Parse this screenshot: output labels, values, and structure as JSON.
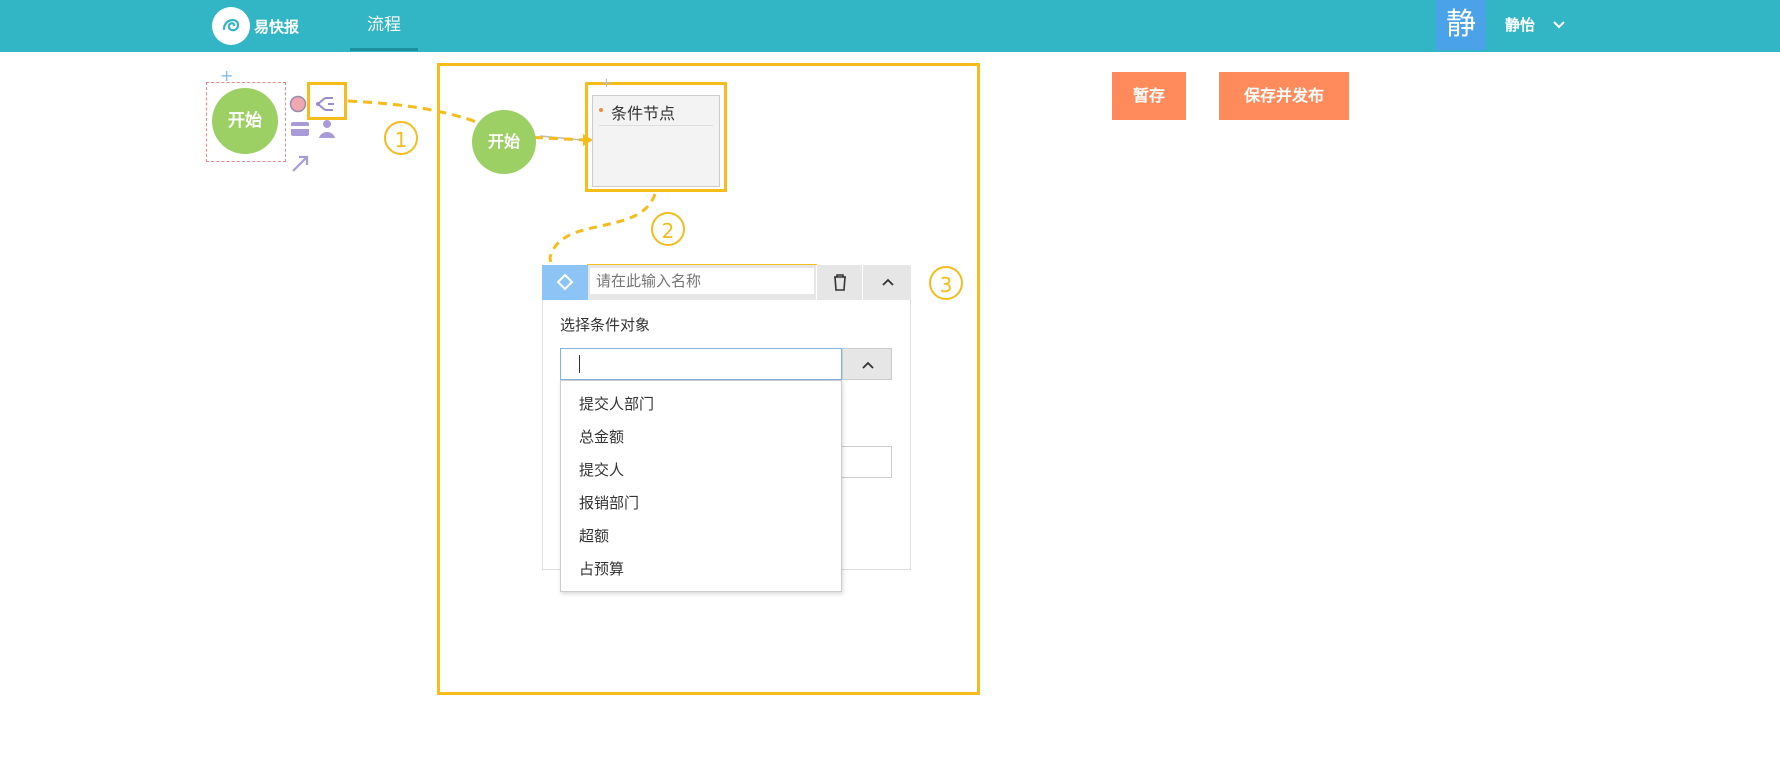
{
  "header": {
    "logo_text": "易快报",
    "nav_tab": "流程",
    "avatar_char": "静",
    "user_name": "静怡"
  },
  "toolbar": {
    "save_draft": "暂存",
    "save_publish": "保存并发布"
  },
  "canvas": {
    "palette_start_label": "开始",
    "flow_start_label": "开始",
    "condition_node_title": "条件节点"
  },
  "annotations": [
    "1",
    "2",
    "3"
  ],
  "panel": {
    "name_placeholder": "请在此输入名称",
    "select_label": "选择条件对象",
    "select_value": "",
    "options": [
      "提交人部门",
      "总金额",
      "提交人",
      "报销部门",
      "超额",
      "占预算"
    ]
  },
  "colors": {
    "topbar": "#32b5c5",
    "accent_button": "#ff8a5b",
    "start_node": "#9ccf64",
    "highlight": "#f5bc1c"
  },
  "icons": [
    "logo-icon",
    "chevron-down-icon",
    "record-icon",
    "branch-icon",
    "card-icon",
    "approver-icon",
    "arrow-icon",
    "diamond-icon",
    "trash-icon",
    "chevron-up-icon"
  ]
}
